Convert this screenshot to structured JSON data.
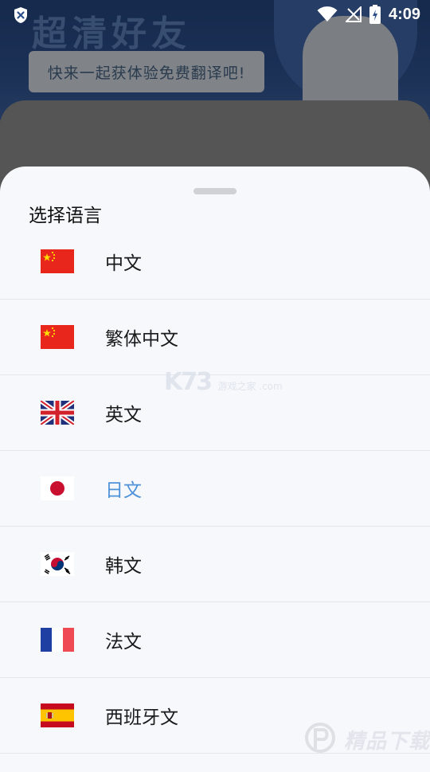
{
  "status_bar": {
    "time": "4:09",
    "icons": [
      "notification-blocked-icon",
      "wifi-icon",
      "signal-off-icon",
      "battery-charging-icon"
    ]
  },
  "background": {
    "banner_title": "超清好友",
    "cta_label": "快来一起获体验免费翻译吧!"
  },
  "sheet": {
    "title": "选择语言",
    "languages": [
      {
        "label": "中文",
        "flag": "china-flag-icon",
        "selected": false
      },
      {
        "label": "繁体中文",
        "flag": "china-flag-icon",
        "selected": false
      },
      {
        "label": "英文",
        "flag": "uk-flag-icon",
        "selected": false
      },
      {
        "label": "日文",
        "flag": "japan-flag-icon",
        "selected": true
      },
      {
        "label": "韩文",
        "flag": "korea-flag-icon",
        "selected": false
      },
      {
        "label": "法文",
        "flag": "france-flag-icon",
        "selected": false
      },
      {
        "label": "西班牙文",
        "flag": "spain-flag-icon",
        "selected": false
      }
    ],
    "selected_color": "#4e93d9"
  },
  "watermarks": {
    "k73": "K73",
    "k73_sub": "游戏之家 .com",
    "jingpin": "精品下载"
  }
}
